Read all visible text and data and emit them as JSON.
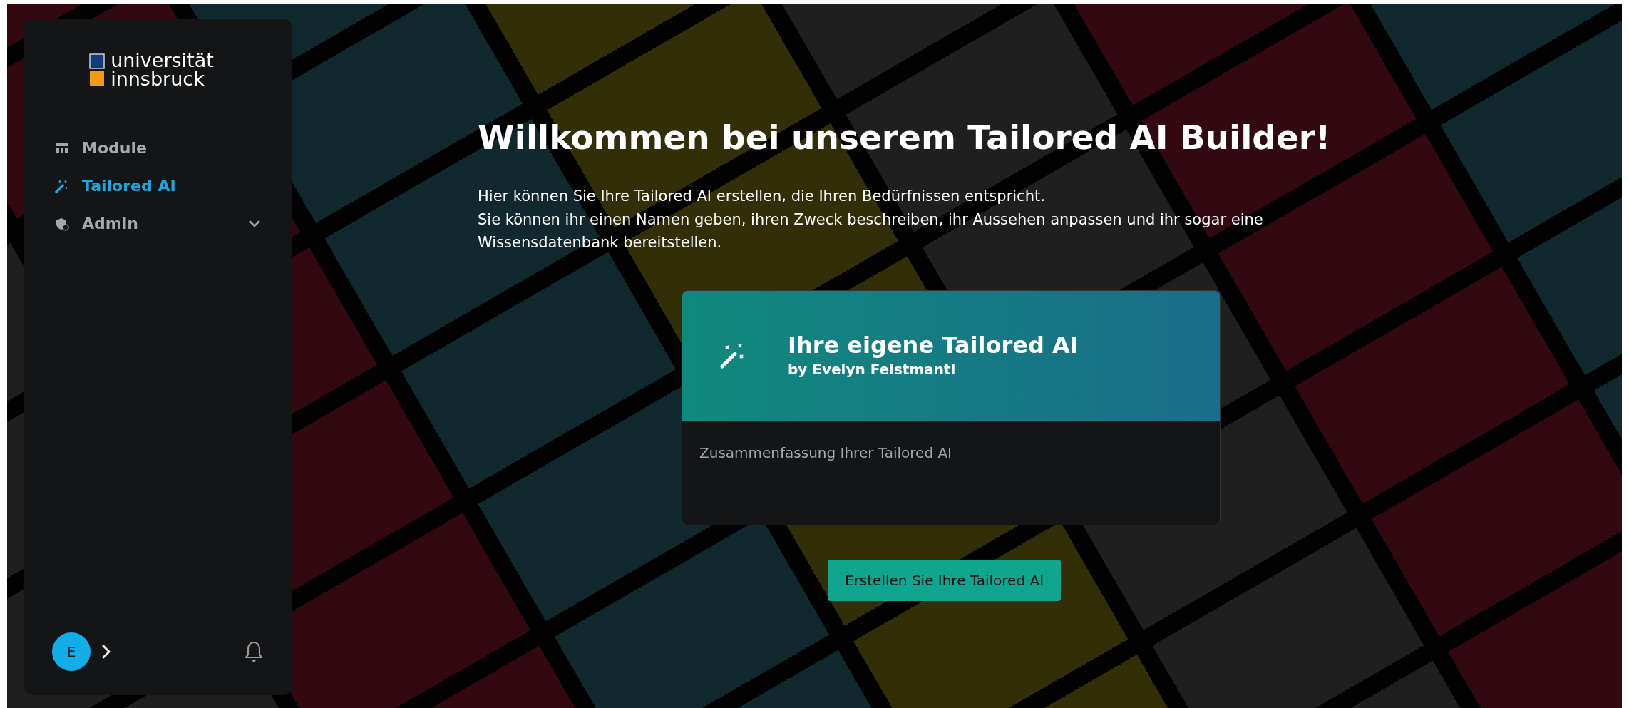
{
  "logo": {
    "line_1": "universität",
    "line_2": "innsbruck"
  },
  "sidebar": {
    "items": [
      {
        "label": "Module",
        "kind": "table",
        "selected": false,
        "expandable": false
      },
      {
        "label": "Tailored AI",
        "kind": "wand",
        "selected": true,
        "expandable": false
      },
      {
        "label": "Admin",
        "kind": "shield",
        "selected": false,
        "expandable": true
      }
    ]
  },
  "user": {
    "initial": "E"
  },
  "hero": {
    "title": "Willkommen bei unserem Tailored AI Builder!",
    "paragraphs": [
      "Hier können Sie Ihre Tailored AI erstellen, die Ihren Bedürfnissen entspricht.",
      "Sie können ihr einen Namen geben, ihren Zweck beschreiben, ihr Aussehen anpassen und ihr sogar eine Wissensdatenbank bereitstellen."
    ]
  },
  "card": {
    "title": "Ihre eigene Tailored AI",
    "author": "by Evelyn Feistmantl",
    "summary": "Zusammenfassung Ihrer Tailored AI"
  },
  "button": "Erstellen Sie Ihre Tailored AI"
}
